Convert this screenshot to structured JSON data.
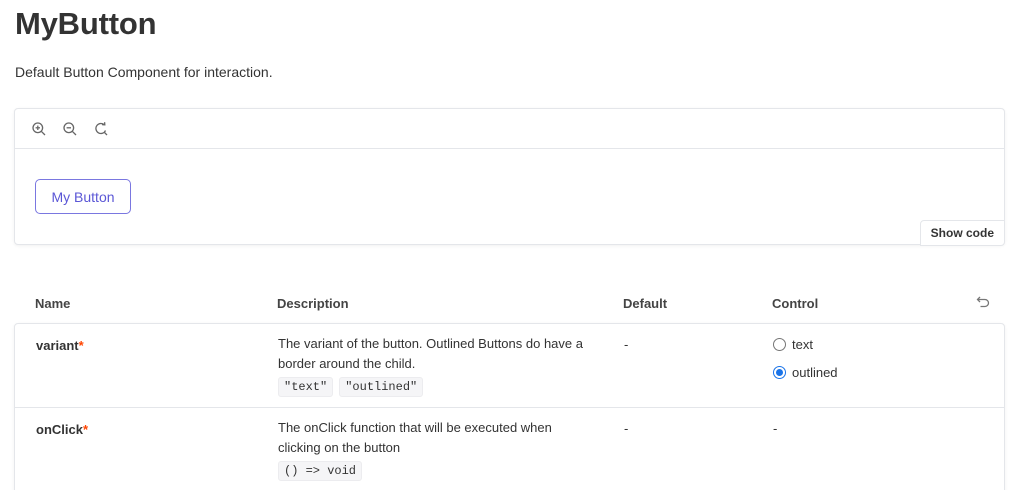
{
  "page": {
    "title": "MyButton",
    "subtitle": "Default Button Component for interaction."
  },
  "toolbar": {
    "icons": [
      "zoom-in-icon",
      "zoom-out-icon",
      "reset-zoom-icon"
    ]
  },
  "preview": {
    "button_label": "My Button",
    "show_code_label": "Show code",
    "accent_color": "#5b57d6"
  },
  "table": {
    "headers": {
      "name": "Name",
      "description": "Description",
      "default": "Default",
      "control": "Control"
    },
    "rows": [
      {
        "name": "variant",
        "required_mark": "*",
        "description": "The variant of the button. Outlined Buttons do have a border around the child.",
        "types": [
          "\"text\"",
          "\"outlined\""
        ],
        "default": "-",
        "control": {
          "options": [
            {
              "label": "text",
              "checked": false
            },
            {
              "label": "outlined",
              "checked": true
            }
          ]
        }
      },
      {
        "name": "onClick",
        "required_mark": "*",
        "description": "The onClick function that will be executed when clicking on the button",
        "types": [
          "() => void"
        ],
        "default": "-",
        "control_text": "-"
      }
    ]
  }
}
